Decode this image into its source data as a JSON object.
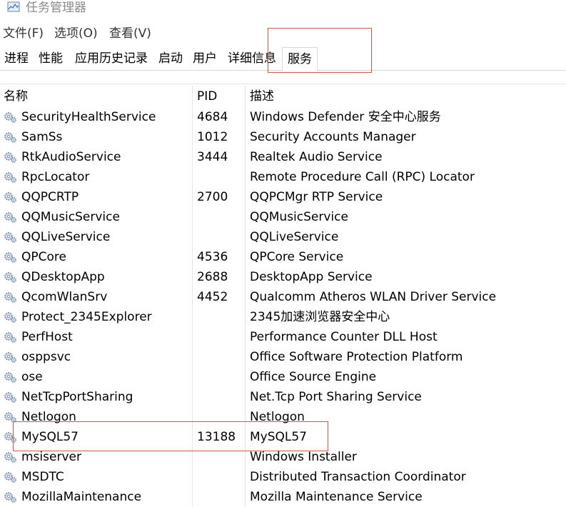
{
  "window": {
    "title": "任务管理器"
  },
  "menu": [
    "文件(F)",
    "选项(O)",
    "查看(V)"
  ],
  "tabs": [
    {
      "label": "进程"
    },
    {
      "label": "性能"
    },
    {
      "label": "应用历史记录"
    },
    {
      "label": "启动"
    },
    {
      "label": "用户"
    },
    {
      "label": "详细信息"
    },
    {
      "label": "服务",
      "active": true
    }
  ],
  "table": {
    "columns": [
      "名称",
      "PID",
      "描述"
    ],
    "rows": [
      {
        "name": "SecurityHealthService",
        "pid": "4684",
        "desc": "Windows Defender 安全中心服务"
      },
      {
        "name": "SamSs",
        "pid": "1012",
        "desc": "Security Accounts Manager"
      },
      {
        "name": "RtkAudioService",
        "pid": "3444",
        "desc": "Realtek Audio Service"
      },
      {
        "name": "RpcLocator",
        "pid": "",
        "desc": "Remote Procedure Call (RPC) Locator"
      },
      {
        "name": "QQPCRTP",
        "pid": "2700",
        "desc": "QQPCMgr RTP Service"
      },
      {
        "name": "QQMusicService",
        "pid": "",
        "desc": "QQMusicService"
      },
      {
        "name": "QQLiveService",
        "pid": "",
        "desc": "QQLiveService"
      },
      {
        "name": "QPCore",
        "pid": "4536",
        "desc": "QPCore Service"
      },
      {
        "name": "QDesktopApp",
        "pid": "2688",
        "desc": "DesktopApp Service"
      },
      {
        "name": "QcomWlanSrv",
        "pid": "4452",
        "desc": "Qualcomm Atheros WLAN Driver Service"
      },
      {
        "name": "Protect_2345Explorer",
        "pid": "",
        "desc": "2345加速浏览器安全中心"
      },
      {
        "name": "PerfHost",
        "pid": "",
        "desc": "Performance Counter DLL Host"
      },
      {
        "name": "osppsvc",
        "pid": "",
        "desc": "Office Software Protection Platform"
      },
      {
        "name": "ose",
        "pid": "",
        "desc": "Office  Source Engine"
      },
      {
        "name": "NetTcpPortSharing",
        "pid": "",
        "desc": "Net.Tcp Port Sharing Service"
      },
      {
        "name": "Netlogon",
        "pid": "",
        "desc": "Netlogon"
      },
      {
        "name": "MySQL57",
        "pid": "13188",
        "desc": "MySQL57"
      },
      {
        "name": "msiserver",
        "pid": "",
        "desc": "Windows Installer"
      },
      {
        "name": "MSDTC",
        "pid": "",
        "desc": "Distributed Transaction Coordinator"
      },
      {
        "name": "MozillaMaintenance",
        "pid": "",
        "desc": "Mozilla Maintenance Service"
      }
    ]
  },
  "colors": {
    "highlight_box": "#d9534f",
    "title_text": "#8a8a8a",
    "gear_icon": "#6a7f99"
  }
}
